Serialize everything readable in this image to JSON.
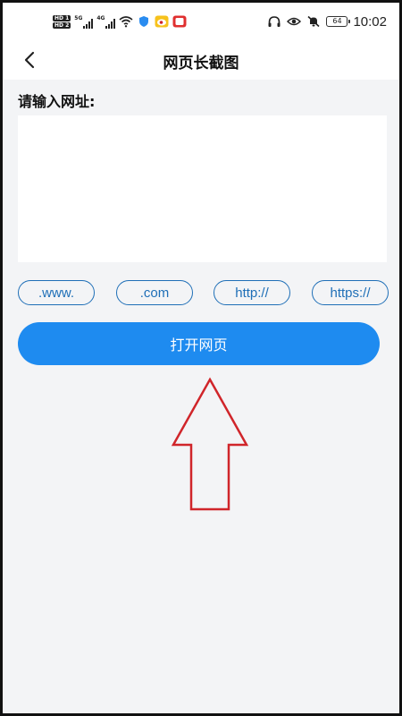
{
  "status_bar": {
    "network_labels": [
      "5G",
      "4G"
    ],
    "hd_labels": [
      "HD 1",
      "HD 2"
    ],
    "battery": "64",
    "time": "10:02"
  },
  "header": {
    "title": "网页长截图"
  },
  "form": {
    "url_label": "请输入网址:",
    "url_value": "",
    "chips": [
      ".www.",
      ".com",
      "http://",
      "https://"
    ],
    "open_button": "打开网页"
  },
  "colors": {
    "accent": "#1e8bf0",
    "chip_border": "#1f6fb7",
    "annotation_arrow": "#d0252a",
    "background": "#f3f4f6"
  }
}
